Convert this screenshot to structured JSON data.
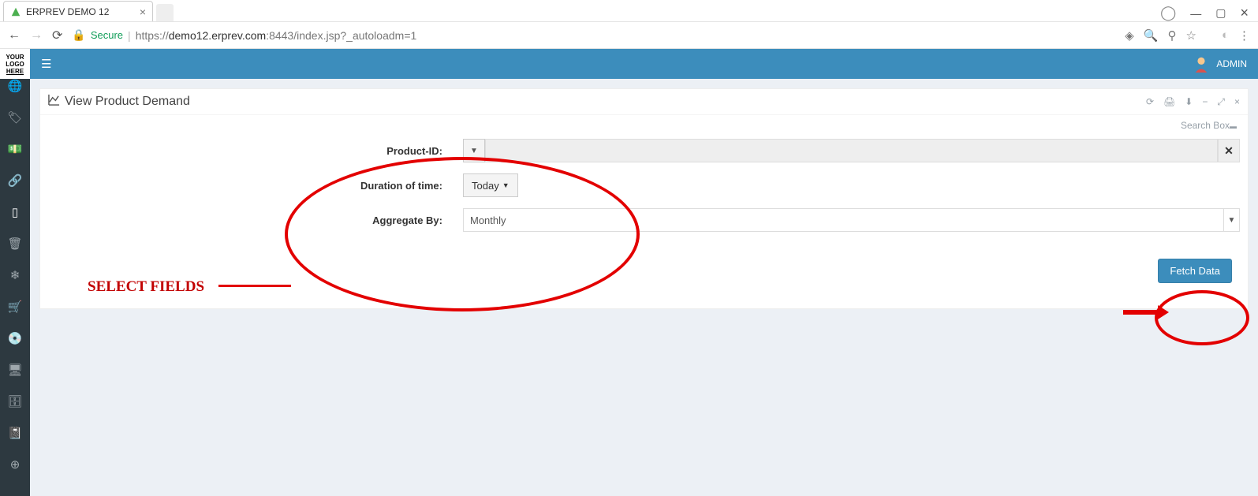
{
  "browser": {
    "tab_title": "ERPREV DEMO 12",
    "secure_label": "Secure",
    "url_prefix": "https://",
    "url_host": "demo12.erprev.com",
    "url_port_path": ":8443/index.jsp?_autoloadm=1"
  },
  "app": {
    "logo_l1": "YOUR",
    "logo_l2": "LOGO",
    "logo_l3": "HERE",
    "user_label": "ADMIN"
  },
  "panel": {
    "title": "View Product Demand",
    "searchbox_label": "Search Box"
  },
  "form": {
    "product_label": "Product-ID:",
    "duration_label": "Duration of time:",
    "duration_value": "Today",
    "aggregate_label": "Aggregate By:",
    "aggregate_value": "Monthly",
    "fetch_label": "Fetch Data"
  },
  "annotation": {
    "text": "SELECT FIELDS"
  }
}
